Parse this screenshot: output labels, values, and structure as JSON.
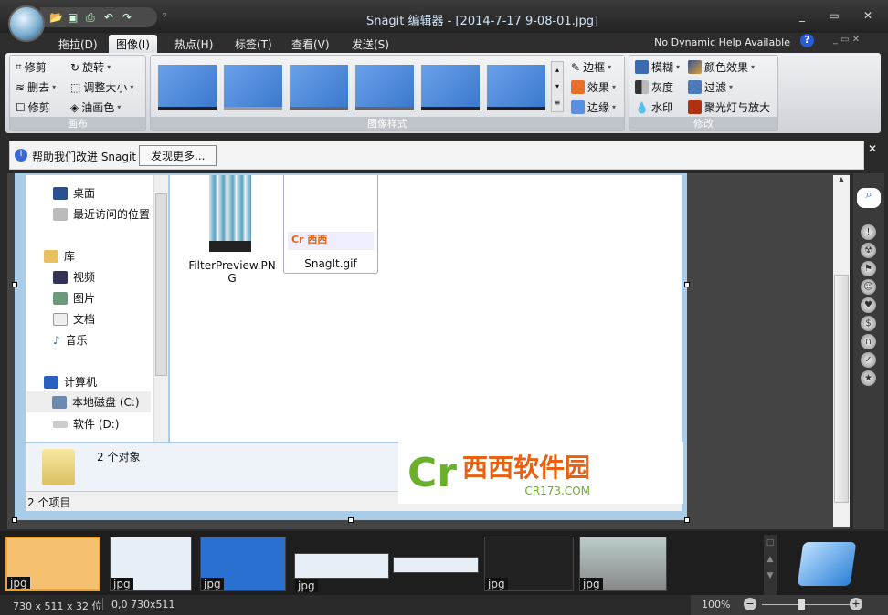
{
  "title": "Snagit 编辑器 - [2014-7-17 9-08-01.jpg]",
  "tabs": [
    "拖拉(D)",
    "图像(I)",
    "热点(H)",
    "标签(T)",
    "查看(V)",
    "发送(S)"
  ],
  "help_text": "No Dynamic Help Available",
  "ribbon": {
    "canvas": {
      "label": "画布",
      "items": [
        "修剪",
        "旋转",
        "删去",
        "调整大小",
        "修剪",
        "油画色"
      ]
    },
    "styles": {
      "label": "图像样式",
      "items": [
        "边框",
        "效果",
        "边缘"
      ]
    },
    "modify": {
      "label": "修改",
      "items": [
        "模糊",
        "颜色效果",
        "灰度",
        "过滤",
        "水印",
        "聚光灯与放大"
      ]
    }
  },
  "notification": {
    "text": "帮助我们改进 Snagit",
    "button": "发现更多..."
  },
  "explorer": {
    "nav": [
      "桌面",
      "最近访问的位置",
      "库",
      "视频",
      "图片",
      "文档",
      "音乐",
      "计算机",
      "本地磁盘 (C:)",
      "软件 (D:)"
    ],
    "files": [
      "FilterPreview.PNG",
      "SnagIt.gif"
    ],
    "details": "2 个对象",
    "status": "2 个项目"
  },
  "watermark": {
    "text": "西西软件园",
    "url": "CR173.COM"
  },
  "tray": {
    "thumbs": [
      "jpg",
      "jpg",
      "jpg",
      "jpg",
      "jpg",
      "jpg"
    ]
  },
  "statusbar": {
    "size": "730 x 511 x 32 位",
    "pos": "0,0  730x511",
    "zoom": "100%"
  }
}
